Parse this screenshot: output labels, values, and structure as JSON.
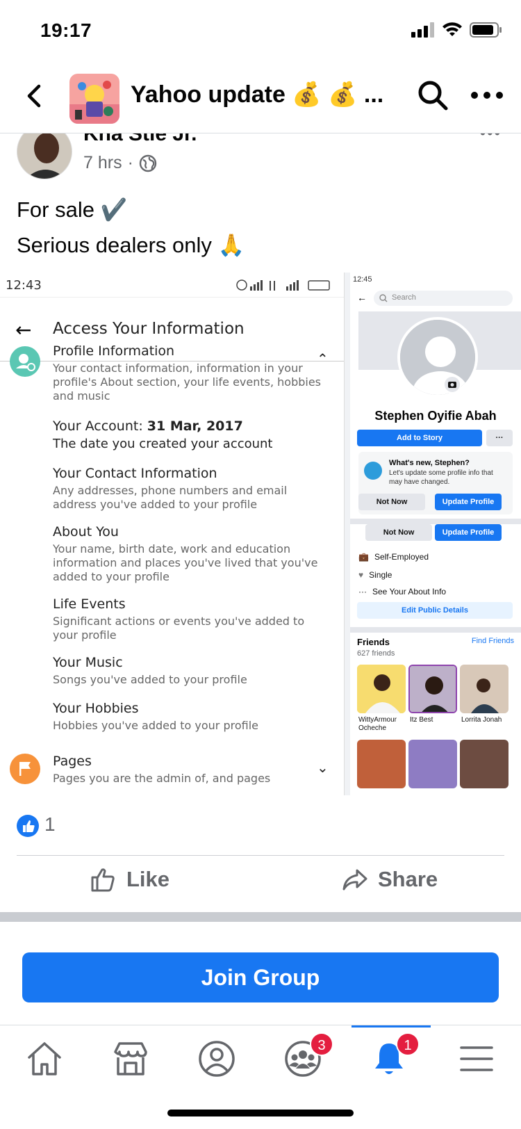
{
  "status_bar": {
    "time": "19:17"
  },
  "header": {
    "title": "Yahoo update 💰 💰 ..."
  },
  "post": {
    "author": "Kha Stle Jr.",
    "time": "7 hrs",
    "separator": "·",
    "more": "•••",
    "text_line1": "For sale ✔️",
    "text_line2": "Serious dealers only 🙏"
  },
  "embedded_left": {
    "time": "12:43",
    "title": "Access Your Information",
    "sections": [
      {
        "heading": "Profile Information",
        "desc": "Your contact information, information in your profile's About section, your life events, hobbies and music"
      },
      {
        "heading_prefix": "Your Account: ",
        "heading_bold": "31 Mar, 2017",
        "desc": "The date you created your account"
      },
      {
        "heading": "Your Contact Information",
        "desc": "Any addresses, phone numbers and email address you've added to your profile"
      },
      {
        "heading": "About You",
        "desc": "Your name, birth date, work and education information and places you've lived that you've added to your profile"
      },
      {
        "heading": "Life Events",
        "desc": "Significant actions or events you've added to your profile"
      },
      {
        "heading": "Your Music",
        "desc": "Songs you've added to your profile"
      },
      {
        "heading": "Your Hobbies",
        "desc": "Hobbies you've added to your profile"
      },
      {
        "heading": "Pages",
        "desc": "Pages you are the admin of, and pages"
      }
    ]
  },
  "embedded_right": {
    "time": "12:45",
    "search_placeholder": "Search",
    "name": "Stephen Oyifie Abah",
    "add_story": "Add to Story",
    "more": "···",
    "card_title": "What's new, Stephen?",
    "card_desc": "Let's update some profile info that may have changed.",
    "not_now": "Not Now",
    "update_profile": "Update Profile",
    "details": [
      "Self-Employed",
      "Single",
      "See Your About Info"
    ],
    "edit_public": "Edit Public Details",
    "friends_title": "Friends",
    "find_friends": "Find Friends",
    "friends_count": "627 friends",
    "friends": [
      "WittyArmour Ocheche",
      "Itz Best",
      "Lorrita Jonah"
    ]
  },
  "reactions": {
    "count": "1"
  },
  "actions": {
    "like": "Like",
    "share": "Share"
  },
  "join_button": "Join Group",
  "tabs": {
    "groups_badge": "3",
    "notifications_badge": "1"
  },
  "colors": {
    "accent": "#1877f2",
    "badge": "#e41e3f",
    "secondary_text": "#65676b"
  }
}
